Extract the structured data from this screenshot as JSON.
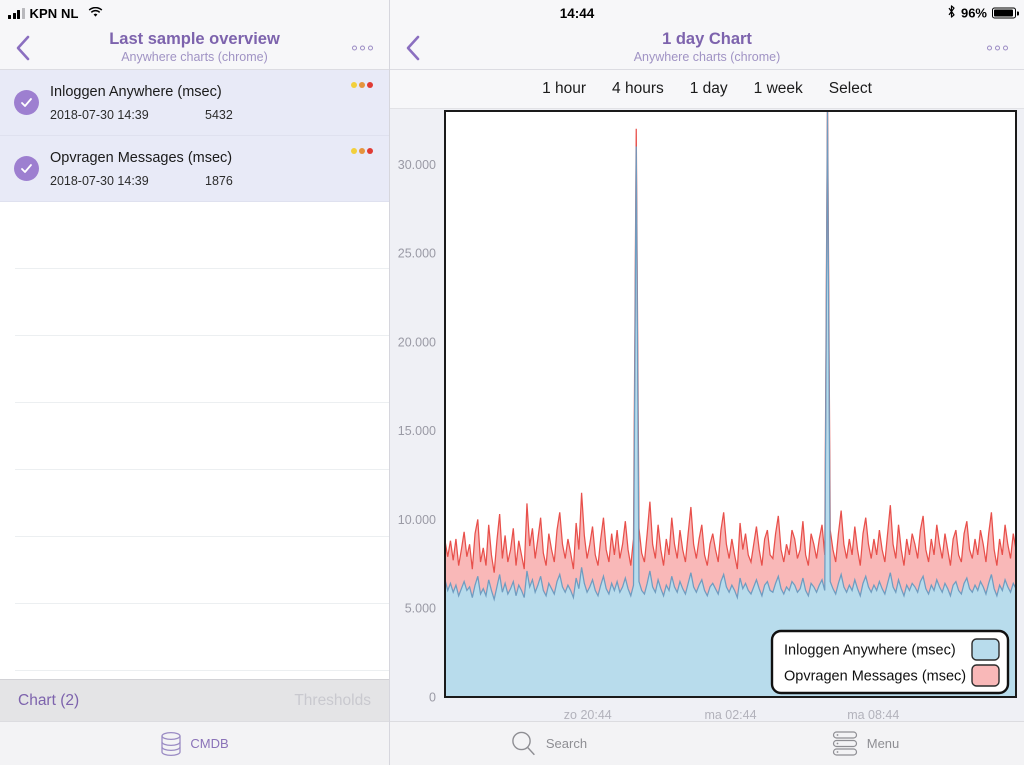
{
  "left": {
    "statusbar": {
      "carrier": "KPN NL",
      "signal_icon": "signal-bars-icon",
      "wifi_icon": "wifi-icon"
    },
    "nav": {
      "back_icon": "chevron-left-icon",
      "title": "Last sample overview",
      "subtitle": "Anywhere charts (chrome)",
      "more_icon": "more-options-icon"
    },
    "rows": [
      {
        "title": "Inloggen Anywhere (msec)",
        "date": "2018-07-30 14:39",
        "value": "5432",
        "checked": true,
        "check_icon": "check-circle-icon",
        "leds": [
          "#f2d03c",
          "#e5943c",
          "#e03b34"
        ]
      },
      {
        "title": "Opvragen Messages (msec)",
        "date": "2018-07-30 14:39",
        "value": "1876",
        "checked": true,
        "check_icon": "check-circle-icon",
        "leds": [
          "#f2d03c",
          "#e5943c",
          "#e03b34"
        ]
      }
    ],
    "empty_row_count": 7,
    "segment": {
      "chart_label": "Chart (2)",
      "thresholds_label": "Thresholds"
    },
    "tab": {
      "icon": "database-icon",
      "label": "CMDB"
    }
  },
  "right": {
    "statusbar": {
      "time": "14:44",
      "bluetooth_icon": "bluetooth-icon",
      "battery_pct": "96%",
      "battery_icon": "battery-icon",
      "battery_level": 96
    },
    "nav": {
      "back_icon": "chevron-left-icon",
      "title": "1 day Chart",
      "subtitle": "Anywhere charts (chrome)",
      "more_icon": "more-options-icon"
    },
    "ranges": [
      "1 hour",
      "4 hours",
      "1 day",
      "1 week",
      "Select"
    ],
    "tabs": [
      {
        "icon": "search-icon",
        "label": "Search"
      },
      {
        "icon": "menu-icon",
        "label": "Menu"
      }
    ]
  },
  "colors": {
    "accent_purple": "#7d63ad",
    "series_blue_fill": "#b8dcec",
    "series_blue_line": "#6f9cc0",
    "series_red_fill": "#f9b8b8",
    "series_red_line": "#e8504b",
    "panel_bg": "#eff0f5"
  },
  "chart_data": {
    "type": "area",
    "title": "1 day Chart",
    "subtitle": "Anywhere charts (chrome)",
    "xlabel": "",
    "ylabel": "",
    "ylim": [
      0,
      33000
    ],
    "yticks": [
      0,
      5000,
      10000,
      15000,
      20000,
      25000,
      30000
    ],
    "ytick_labels": [
      "0",
      "5.000",
      "10.000",
      "15.000",
      "20.000",
      "25.000",
      "30.000"
    ],
    "xtick_labels": [
      "zo 20:44",
      "ma 02:44",
      "ma 08:44"
    ],
    "xtick_positions": [
      0.25,
      0.5,
      0.75
    ],
    "grid": false,
    "stacked": true,
    "legend_position": "bottom-right",
    "legend": [
      {
        "name": "Inloggen Anywhere (msec)",
        "color": "#b8dcec"
      },
      {
        "name": "Opvragen Messages (msec)",
        "color": "#f9b8b8"
      }
    ],
    "series": [
      {
        "name": "Inloggen Anywhere (msec)",
        "fill": "#b8dcec",
        "line": "#6f9cc0",
        "values": [
          6600,
          6000,
          6400,
          5900,
          6300,
          5700,
          6100,
          6500,
          6000,
          6200,
          5600,
          6300,
          6800,
          5800,
          6100,
          5700,
          6600,
          6000,
          5500,
          6200,
          6900,
          5900,
          6400,
          5800,
          6100,
          6500,
          5700,
          6300,
          6000,
          5600,
          7100,
          6200,
          6600,
          5900,
          6300,
          6800,
          6000,
          5700,
          6400,
          6100,
          5800,
          6500,
          6900,
          6200,
          5900,
          6300,
          6000,
          5600,
          6700,
          6100,
          7300,
          6400,
          5900,
          6200,
          6600,
          6000,
          5700,
          6300,
          6800,
          6100,
          5800,
          6400,
          6000,
          6500,
          5900,
          6200,
          6700,
          6100,
          5700,
          6300,
          31000,
          6500,
          6000,
          5800,
          6400,
          7100,
          6200,
          5900,
          6600,
          6100,
          5700,
          6300,
          6000,
          6800,
          6200,
          5900,
          6500,
          6100,
          5800,
          6400,
          7000,
          6200,
          5900,
          6300,
          6600,
          6000,
          5700,
          6200,
          6400,
          6100,
          5800,
          6500,
          6900,
          6200,
          5900,
          6300,
          6000,
          5600,
          6700,
          6100,
          6400,
          6000,
          5800,
          6200,
          6600,
          6100,
          5700,
          6300,
          6500,
          6000,
          5900,
          6400,
          6800,
          6100,
          5800,
          6200,
          6000,
          6500,
          6300,
          5900,
          6100,
          6700,
          6000,
          5700,
          6400,
          6200,
          5900,
          6300,
          6600,
          6000,
          33000,
          6500,
          6100,
          5800,
          6400,
          6900,
          6200,
          5900,
          6300,
          6000,
          6600,
          6100,
          5700,
          6400,
          6800,
          6200,
          5900,
          6300,
          6000,
          6500,
          6100,
          5800,
          6400,
          7000,
          6200,
          5900,
          6600,
          6100,
          5700,
          6300,
          6000,
          6400,
          6200,
          5900,
          6500,
          6800,
          6100,
          5800,
          6300,
          6000,
          6600,
          6200,
          5900,
          6400,
          6100,
          5700,
          6300,
          6500,
          6000,
          5800,
          6400,
          6700,
          6100,
          5900,
          6300,
          6000,
          6500,
          6200,
          5800,
          6400,
          6900,
          6100,
          5700,
          6300,
          6000,
          6600,
          6200,
          5900,
          6400,
          6100
        ]
      },
      {
        "name": "Opvragen Messages (msec)",
        "fill": "#f9b8b8",
        "line": "#e8504b",
        "values": [
          2200,
          1900,
          2400,
          1800,
          2600,
          1700,
          2200,
          2800,
          1900,
          2400,
          1600,
          2900,
          3200,
          1800,
          2300,
          1700,
          3100,
          2000,
          1500,
          2600,
          3400,
          1900,
          2700,
          1800,
          2200,
          3000,
          1700,
          2500,
          2000,
          1600,
          3800,
          2300,
          2900,
          1900,
          2600,
          3300,
          2100,
          1700,
          2800,
          2200,
          1800,
          2900,
          3500,
          2400,
          1900,
          2600,
          2100,
          1600,
          3100,
          2200,
          4200,
          2700,
          1900,
          2400,
          3000,
          2000,
          1700,
          2600,
          3300,
          2200,
          1800,
          2800,
          2000,
          2900,
          1900,
          2400,
          3200,
          2200,
          1700,
          2600,
          1000,
          3000,
          2100,
          1800,
          2800,
          3900,
          2400,
          1900,
          3100,
          2200,
          1700,
          2600,
          2000,
          3300,
          2400,
          1900,
          2900,
          2200,
          1800,
          2800,
          3700,
          2400,
          1900,
          2600,
          3100,
          2000,
          1700,
          2400,
          2800,
          2200,
          1800,
          2900,
          3500,
          2400,
          1900,
          2600,
          2000,
          1600,
          3100,
          2200,
          2800,
          2000,
          1800,
          2400,
          3000,
          2200,
          1700,
          2600,
          2900,
          2000,
          1900,
          2800,
          3400,
          2200,
          1800,
          2400,
          2000,
          2900,
          2600,
          1900,
          2200,
          3200,
          2000,
          1700,
          2800,
          2400,
          1900,
          2600,
          3100,
          2000,
          1000,
          2900,
          2200,
          1800,
          2800,
          3600,
          2400,
          1900,
          2600,
          2000,
          3000,
          2200,
          1700,
          2800,
          3300,
          2400,
          1900,
          2600,
          2000,
          2900,
          2200,
          1800,
          2800,
          3800,
          2400,
          1900,
          3100,
          2200,
          1700,
          2600,
          2000,
          2800,
          2400,
          1900,
          2900,
          3400,
          2200,
          1800,
          2600,
          2000,
          3100,
          2400,
          1900,
          2800,
          2200,
          1700,
          2600,
          2900,
          2000,
          1800,
          2800,
          3200,
          2200,
          1900,
          2600,
          2000,
          2900,
          2400,
          1800,
          2800,
          3500,
          2200,
          1700,
          2600,
          2000,
          3100,
          2400,
          1900,
          2800,
          2200
        ]
      }
    ]
  }
}
